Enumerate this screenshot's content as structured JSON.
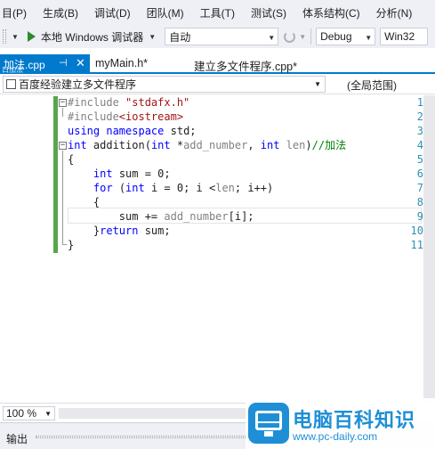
{
  "menu": {
    "items": [
      "目(P)",
      "生成(B)",
      "调试(D)",
      "团队(M)",
      "工具(T)",
      "测试(S)",
      "体系结构(C)",
      "分析(N)"
    ]
  },
  "toolbar": {
    "run_label": "本地 Windows 调试器",
    "config_value": "自动",
    "build_config": "Debug",
    "platform": "Win32"
  },
  "tabs": {
    "active": "加法.cpp",
    "overlay": "口加法",
    "items": [
      "myMain.h*",
      "建立多文件程序.cpp*"
    ]
  },
  "navbar": {
    "project": "百度经验建立多文件程序",
    "scope": "(全局范围)"
  },
  "code": {
    "line_numbers": [
      "1",
      "2",
      "3",
      "4",
      "5",
      "6",
      "7",
      "8",
      "9",
      "10",
      "11"
    ],
    "lines": [
      [
        {
          "t": "#include ",
          "c": "pp"
        },
        {
          "t": "\"stdafx.h\"",
          "c": "str"
        }
      ],
      [
        {
          "t": "#include",
          "c": "pp"
        },
        {
          "t": "<iostream>",
          "c": "str"
        }
      ],
      [
        {
          "t": "using",
          "c": "kw"
        },
        {
          "t": " "
        },
        {
          "t": "namespace",
          "c": "kw"
        },
        {
          "t": " std;"
        }
      ],
      [
        {
          "t": "int",
          "c": "kw"
        },
        {
          "t": " addition("
        },
        {
          "t": "int",
          "c": "kw"
        },
        {
          "t": " *"
        },
        {
          "t": "add_number",
          "c": "param"
        },
        {
          "t": ", "
        },
        {
          "t": "int",
          "c": "kw"
        },
        {
          "t": " "
        },
        {
          "t": "len",
          "c": "param"
        },
        {
          "t": ")"
        },
        {
          "t": "//加法",
          "c": "cmt"
        }
      ],
      [
        {
          "t": "{"
        }
      ],
      [
        {
          "t": "    "
        },
        {
          "t": "int",
          "c": "kw"
        },
        {
          "t": " sum = 0;"
        }
      ],
      [
        {
          "t": "    "
        },
        {
          "t": "for",
          "c": "kw"
        },
        {
          "t": " ("
        },
        {
          "t": "int",
          "c": "kw"
        },
        {
          "t": " i = 0; i <"
        },
        {
          "t": "len",
          "c": "param"
        },
        {
          "t": "; i++)"
        }
      ],
      [
        {
          "t": "    {"
        }
      ],
      [
        {
          "t": "        sum += "
        },
        {
          "t": "add_number",
          "c": "param"
        },
        {
          "t": "[i];"
        }
      ],
      [
        {
          "t": "    }"
        },
        {
          "t": "return",
          "c": "kw"
        },
        {
          "t": " sum;"
        }
      ],
      [
        {
          "t": "}"
        }
      ]
    ]
  },
  "zoom": "100 %",
  "output": {
    "label": "输出"
  },
  "watermark": {
    "title": "电脑百科知识",
    "url": "www.pc-daily.com"
  }
}
